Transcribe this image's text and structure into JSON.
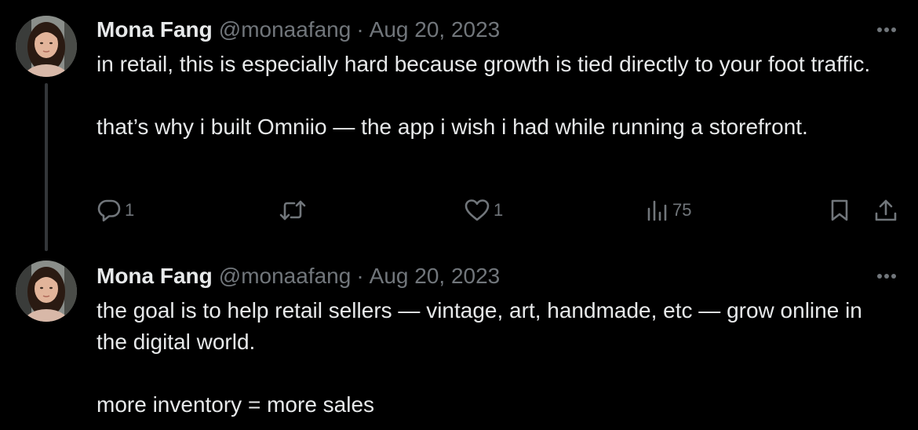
{
  "tweets": [
    {
      "author": {
        "name": "Mona Fang",
        "handle": "@monaafang",
        "separator": "·",
        "date": "Aug 20, 2023"
      },
      "paragraphs": [
        "in retail, this is especially hard because growth is tied directly to your foot traffic.",
        "that’s why i built Omniio — the app i wish i had while running a storefront."
      ],
      "stats": {
        "replies": "1",
        "likes": "1",
        "views": "75"
      }
    },
    {
      "author": {
        "name": "Mona Fang",
        "handle": "@monaafang",
        "separator": "·",
        "date": "Aug 20, 2023"
      },
      "paragraphs": [
        "the goal is to help retail sellers — vintage, art, handmade, etc — grow online in the digital world.",
        "more inventory = more sales"
      ]
    }
  ],
  "icons": {
    "more": "more-horizontal-icon",
    "reply": "reply-bubble-icon",
    "retweet": "retweet-arrows-icon",
    "like": "heart-icon",
    "views": "bar-chart-icon",
    "bookmark": "bookmark-icon",
    "share": "share-upload-icon"
  },
  "colors": {
    "background": "#000000",
    "text_primary": "#e7e9ea",
    "text_secondary": "#71767b",
    "thread_line": "#333639"
  }
}
